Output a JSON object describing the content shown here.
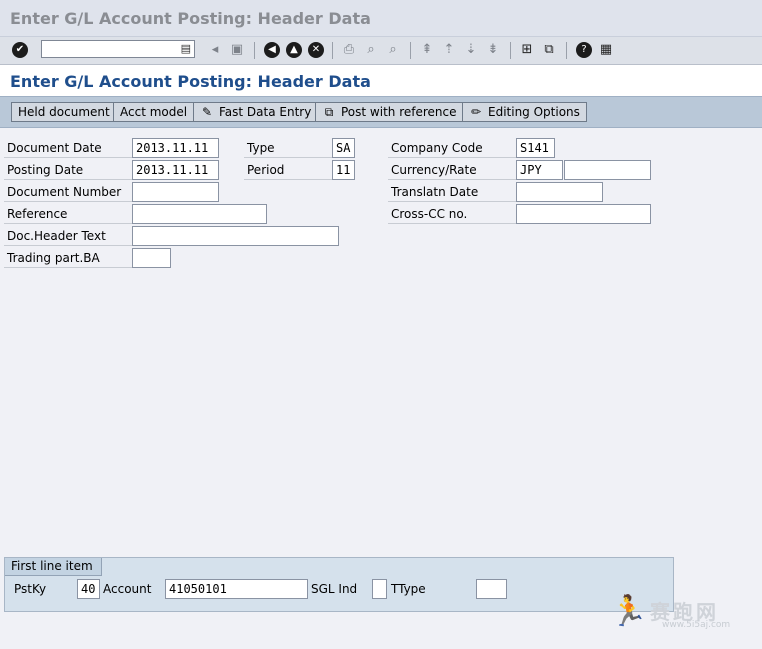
{
  "window": {
    "title": "Enter G/L Account Posting: Header Data"
  },
  "toolbar": {
    "command_value": ""
  },
  "screen": {
    "title": "Enter G/L Account Posting: Header Data"
  },
  "app_toolbar": {
    "held_document": "Held document",
    "acct_model": "Acct model",
    "fast_data_entry": "Fast Data Entry",
    "post_with_reference": "Post with reference",
    "editing_options": "Editing Options"
  },
  "header": {
    "document_date": {
      "label": "Document Date",
      "value": "2013.11.11"
    },
    "posting_date": {
      "label": "Posting Date",
      "value": "2013.11.11"
    },
    "document_number": {
      "label": "Document Number",
      "value": ""
    },
    "reference": {
      "label": "Reference",
      "value": ""
    },
    "doc_header_text": {
      "label": "Doc.Header Text",
      "value": ""
    },
    "trading_part_ba": {
      "label": "Trading part.BA",
      "value": ""
    },
    "type": {
      "label": "Type",
      "value": "SA"
    },
    "period": {
      "label": "Period",
      "value": "11"
    },
    "company_code": {
      "label": "Company Code",
      "value": "S141"
    },
    "currency_rate": {
      "label": "Currency/Rate",
      "currency": "JPY",
      "rate": ""
    },
    "translatn_date": {
      "label": "Translatn Date",
      "value": ""
    },
    "cross_cc_no": {
      "label": "Cross-CC no.",
      "value": ""
    }
  },
  "first_line_item": {
    "title": "First line item",
    "pstky": {
      "label": "PstKy",
      "value": "40"
    },
    "account": {
      "label": "Account",
      "value": "41050101"
    },
    "sgl_ind": {
      "label": "SGL Ind",
      "value": ""
    },
    "ttype": {
      "label": "TType",
      "value": ""
    }
  },
  "watermark": {
    "text": "赛跑网",
    "url": "www.5i5aj.com"
  }
}
